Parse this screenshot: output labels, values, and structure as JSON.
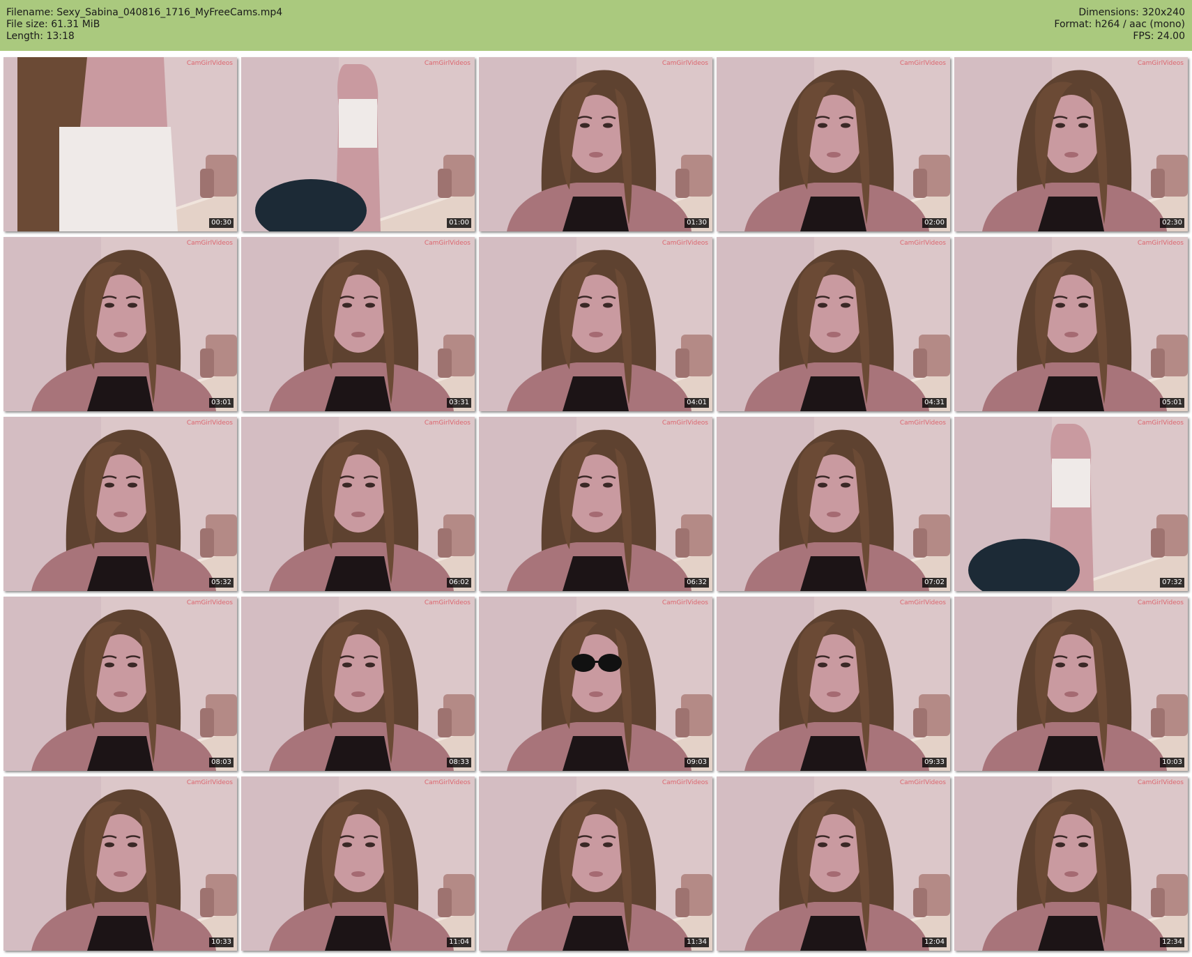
{
  "header": {
    "filename": "Filename: Sexy_Sabina_040816_1716_MyFreeCams.mp4",
    "filesize": "File size: 61.31 MiB",
    "length": "Length: 13:18",
    "dimensions": "Dimensions: 320x240",
    "format": "Format: h264 / aac (mono)",
    "fps": "FPS: 24.00",
    "background": "#aac97e"
  },
  "watermark": "CamGirlVideos",
  "thumbnails": [
    {
      "time": "00:30",
      "scene": "torso-hair"
    },
    {
      "time": "01:00",
      "scene": "standing-back"
    },
    {
      "time": "01:30",
      "scene": "seated-far"
    },
    {
      "time": "02:00",
      "scene": "face"
    },
    {
      "time": "02:30",
      "scene": "face"
    },
    {
      "time": "03:01",
      "scene": "face"
    },
    {
      "time": "03:31",
      "scene": "face"
    },
    {
      "time": "04:01",
      "scene": "face"
    },
    {
      "time": "04:31",
      "scene": "face"
    },
    {
      "time": "05:01",
      "scene": "face"
    },
    {
      "time": "05:32",
      "scene": "face"
    },
    {
      "time": "06:02",
      "scene": "face"
    },
    {
      "time": "06:32",
      "scene": "face"
    },
    {
      "time": "07:02",
      "scene": "face"
    },
    {
      "time": "07:32",
      "scene": "standing-far"
    },
    {
      "time": "08:03",
      "scene": "face"
    },
    {
      "time": "08:33",
      "scene": "face"
    },
    {
      "time": "09:03",
      "scene": "face-sunglasses"
    },
    {
      "time": "09:33",
      "scene": "face"
    },
    {
      "time": "10:03",
      "scene": "face"
    },
    {
      "time": "10:33",
      "scene": "face"
    },
    {
      "time": "11:04",
      "scene": "face"
    },
    {
      "time": "11:34",
      "scene": "face"
    },
    {
      "time": "12:04",
      "scene": "face"
    },
    {
      "time": "12:34",
      "scene": "face"
    }
  ]
}
